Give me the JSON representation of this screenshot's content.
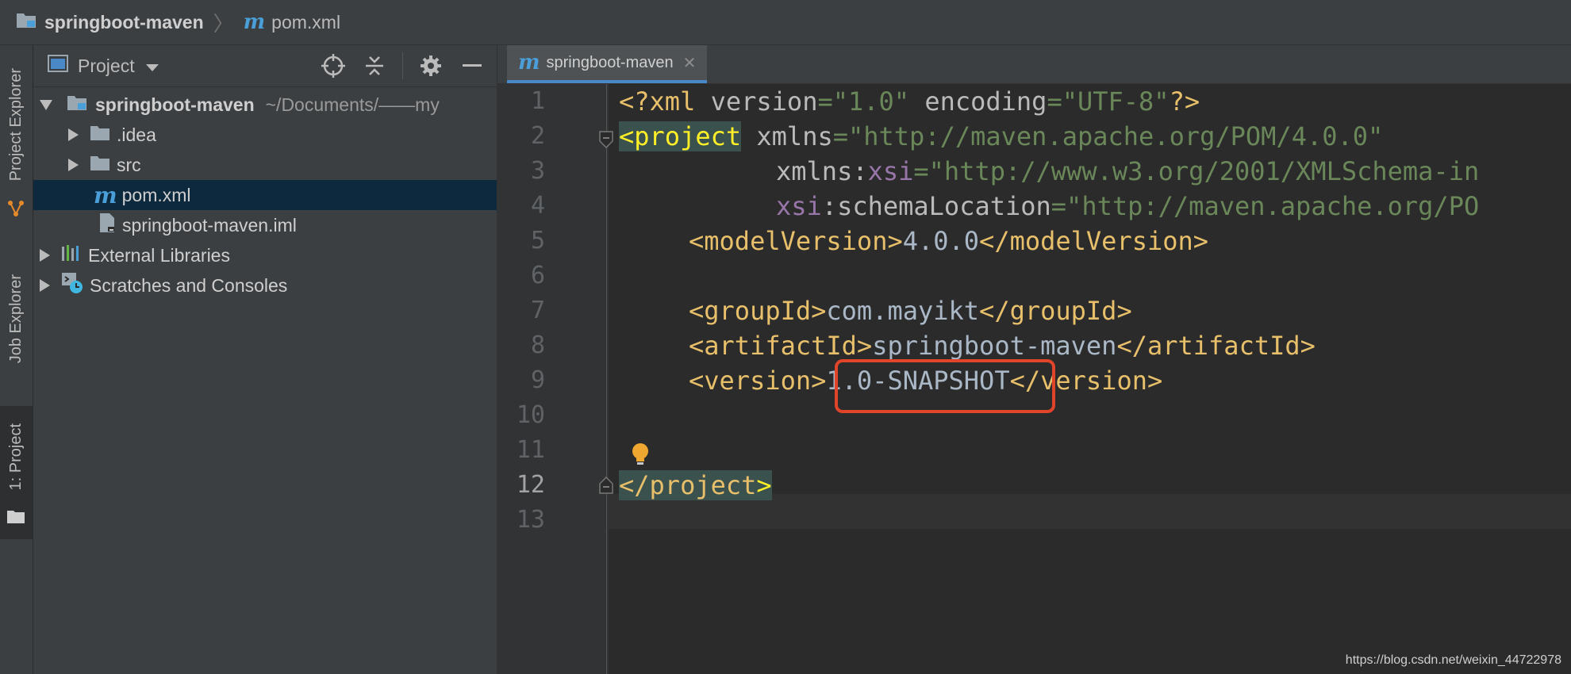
{
  "breadcrumb": {
    "project": "springboot-maven",
    "file": "pom.xml"
  },
  "tool_strip": {
    "tabs": [
      {
        "label": "Project Explorer"
      },
      {
        "label": "Job Explorer"
      },
      {
        "label": "1: Project",
        "active": true
      }
    ]
  },
  "project_panel": {
    "title": "Project",
    "tree": [
      {
        "label": "springboot-maven",
        "path": "~/Documents/——my",
        "expanded": true
      },
      {
        "label": ".idea"
      },
      {
        "label": "src"
      },
      {
        "label": "pom.xml",
        "selected": true
      },
      {
        "label": "springboot-maven.iml"
      },
      {
        "label": "External Libraries"
      },
      {
        "label": "Scratches and Consoles"
      }
    ]
  },
  "editor": {
    "tab_label": "springboot-maven",
    "current_line": 12,
    "line_numbers": [
      "1",
      "2",
      "3",
      "4",
      "5",
      "6",
      "7",
      "8",
      "9",
      "10",
      "11",
      "12",
      "13"
    ],
    "code": {
      "l1": {
        "p1": "<?xml ",
        "p2": "version",
        "p3": "=",
        "p4": "\"1.0\"",
        "p5": " encoding",
        "p6": "=",
        "p7": "\"UTF-8\"",
        "p8": "?>"
      },
      "l2": {
        "p1": "<project",
        "p2": " xmlns",
        "p3": "=",
        "p4": "\"http://maven.apache.org/POM/4.0.0\""
      },
      "l3": {
        "p1": "xmlns",
        "p2": ":",
        "p3": "xsi",
        "p4": "=",
        "p5": "\"http://www.w3.org/2001/XMLSchema-in"
      },
      "l4": {
        "p1": "xsi",
        "p2": ":schemaLocation",
        "p3": "=",
        "p4": "\"http://maven.apache.org/PO"
      },
      "l5": {
        "p1": "<modelVersion>",
        "p2": "4.0.0",
        "p3": "</modelVersion>"
      },
      "l7": {
        "p1": "<groupId>",
        "p2": "com.mayikt",
        "p3": "</groupId>"
      },
      "l8": {
        "p1": "<artifactId>",
        "p2": "springboot-maven",
        "p3": "</artifactId>"
      },
      "l9": {
        "p1": "<version>",
        "p2": "1.0-SNAPSHOT",
        "p3": "</version>"
      },
      "l12": {
        "p1": "</project",
        "p2": ">"
      }
    }
  },
  "watermark": "https://blog.csdn.net/weixin_44722978",
  "colors": {
    "annotation_box": "#e0452a",
    "selection": "#0d293e",
    "tag": "#e8bf6a",
    "string": "#6a8759"
  }
}
